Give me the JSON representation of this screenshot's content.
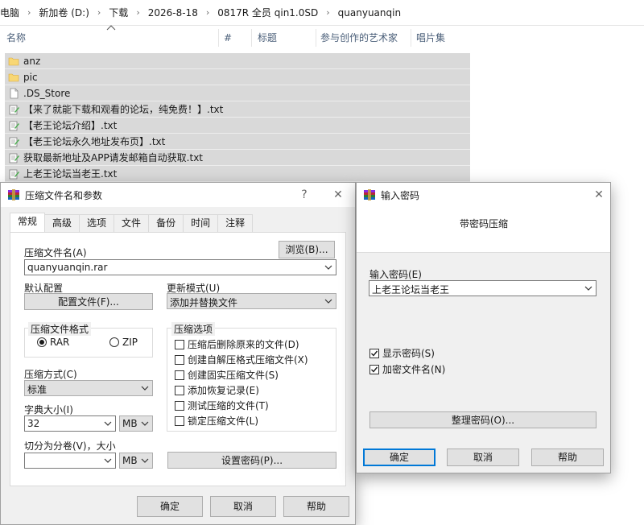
{
  "breadcrumb": [
    "电脑",
    "新加卷 (D:)",
    "下载",
    "2026-8-18",
    "0817R 全员 qin1.0SD",
    "quanyuanqin"
  ],
  "columns": [
    "名称",
    "#",
    "标题",
    "参与创作的艺术家",
    "唱片集"
  ],
  "files": [
    {
      "name": "anz",
      "icon": "folder-icon"
    },
    {
      "name": "pic",
      "icon": "folder-icon"
    },
    {
      "name": ".DS_Store",
      "icon": "file-icon"
    },
    {
      "name": "【来了就能下载和观看的论坛，纯免费！】.txt",
      "icon": "text-file-icon"
    },
    {
      "name": "【老王论坛介绍】.txt",
      "icon": "text-file-icon"
    },
    {
      "name": "【老王论坛永久地址发布页】.txt",
      "icon": "text-file-icon"
    },
    {
      "name": "获取最新地址及APP请发邮箱自动获取.txt",
      "icon": "text-file-icon"
    },
    {
      "name": "上老王论坛当老王.txt",
      "icon": "text-file-icon"
    }
  ],
  "archive_dialog": {
    "title": "压缩文件名和参数",
    "help": "?",
    "close": "✕",
    "tabs": [
      "常规",
      "高级",
      "选项",
      "文件",
      "备份",
      "时间",
      "注释"
    ],
    "archive_name_label": "压缩文件名(A)",
    "browse_button": "浏览(B)...",
    "archive_name_value": "quanyuanqin.rar",
    "default_profile_label": "默认配置",
    "profile_button": "配置文件(F)...",
    "update_mode_label": "更新模式(U)",
    "update_mode_value": "添加并替换文件",
    "format_group_title": "压缩文件格式",
    "format_rar": "RAR",
    "format_zip": "ZIP",
    "method_label": "压缩方式(C)",
    "method_value": "标准",
    "dict_label": "字典大小(I)",
    "dict_value": "32",
    "dict_unit": "MB",
    "split_label": "切分为分卷(V)，大小",
    "split_value": "",
    "split_unit": "MB",
    "options_group_title": "压缩选项",
    "options": [
      {
        "label": "压缩后删除原来的文件(D)",
        "checked": false
      },
      {
        "label": "创建自解压格式压缩文件(X)",
        "checked": false
      },
      {
        "label": "创建固实压缩文件(S)",
        "checked": false
      },
      {
        "label": "添加恢复记录(E)",
        "checked": false
      },
      {
        "label": "测试压缩的文件(T)",
        "checked": false
      },
      {
        "label": "锁定压缩文件(L)",
        "checked": false
      }
    ],
    "set_password_button": "设置密码(P)...",
    "ok_button": "确定",
    "cancel_button": "取消",
    "help_button": "帮助"
  },
  "password_dialog": {
    "title": "输入密码",
    "close": "✕",
    "heading": "带密码压缩",
    "password_label": "输入密码(E)",
    "password_value": "上老王论坛当老王",
    "show_password": {
      "label": "显示密码(S)",
      "checked": true
    },
    "encrypt_names": {
      "label": "加密文件名(N)",
      "checked": true
    },
    "organize_button": "整理密码(O)...",
    "ok_button": "确定",
    "cancel_button": "取消",
    "help_button": "帮助"
  },
  "colors": {
    "accent": "#0078d7",
    "selection": "#d9d9d9",
    "folder": "#f8d775",
    "winrar_red": "#b8283a"
  }
}
